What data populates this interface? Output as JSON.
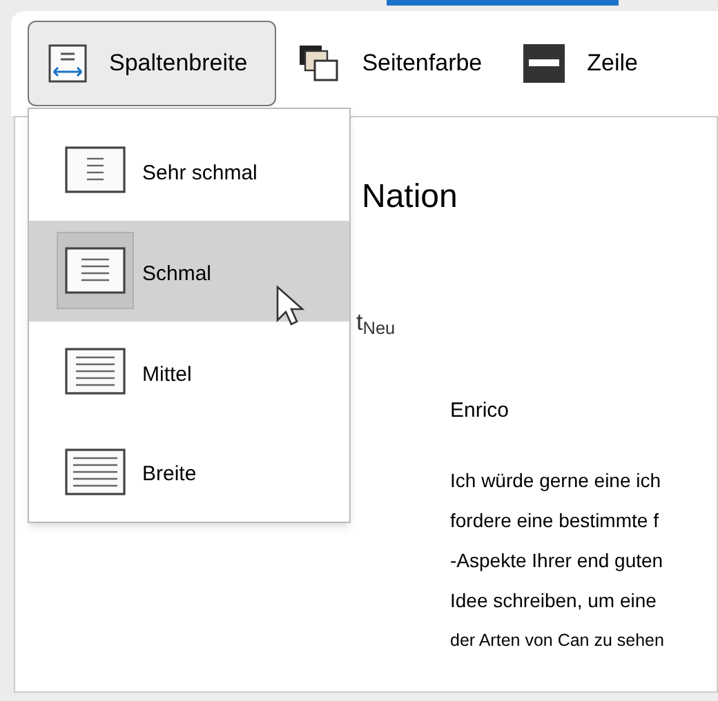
{
  "toolbar": [
    {
      "label": "Spaltenbreite",
      "kind": "columns",
      "expanded": true
    },
    {
      "label": "Seitenfarbe",
      "kind": "pagecolor",
      "expanded": false
    },
    {
      "label": "Zeile",
      "kind": "line",
      "expanded": false
    }
  ],
  "menu": [
    {
      "label": "Sehr schmal",
      "kind": "verynarrow",
      "selected": false
    },
    {
      "label": "Schmal",
      "kind": "narrow",
      "selected": true
    },
    {
      "label": "Mittel",
      "kind": "medium",
      "selected": false
    },
    {
      "label": "Breite",
      "kind": "wide",
      "selected": false
    }
  ],
  "document": {
    "title": "Nation",
    "subtitle": "t$_{Neu}$",
    "greeting": "Enrico",
    "lines": [
      {
        "text": "Ich würde gerne eine ich",
        "small": false
      },
      {
        "text": "fordere eine bestimmte f",
        "small": false
      },
      {
        "text": "-Aspekte Ihrer end guten",
        "small": false
      },
      {
        "text": "Idee schreiben, um eine",
        "small": false
      },
      {
        "text": "der Arten von Can zu sehen",
        "small": true
      }
    ]
  }
}
